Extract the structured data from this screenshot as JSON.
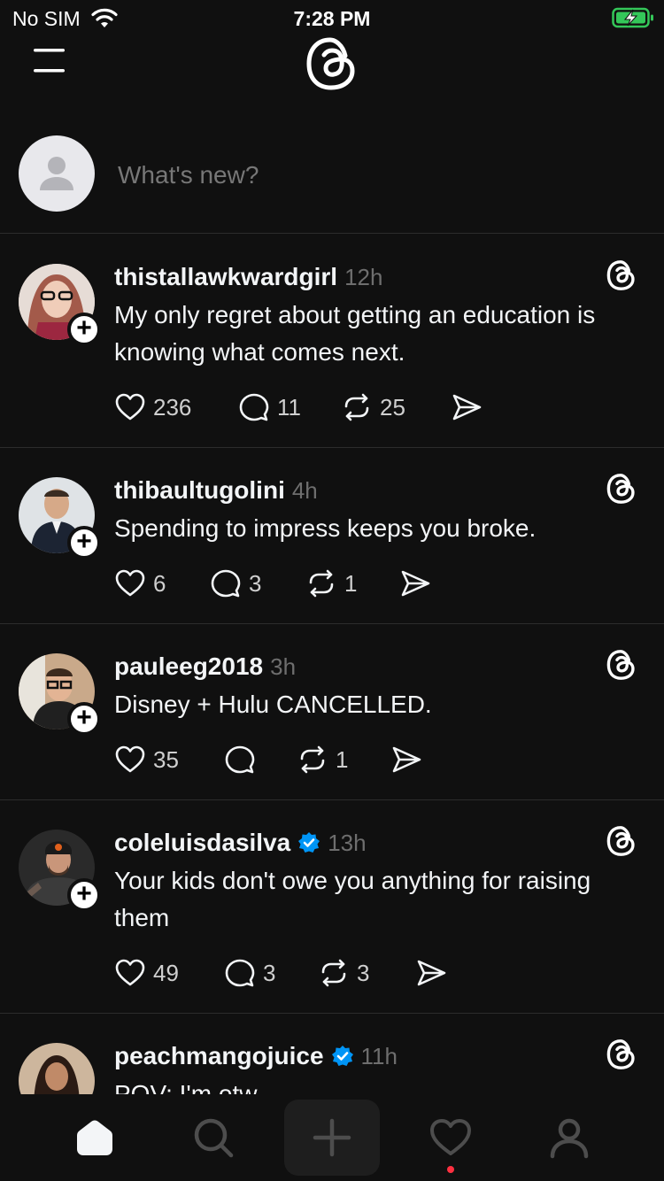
{
  "status_bar": {
    "carrier": "No SIM",
    "time": "7:28 PM",
    "battery_color": "#34c759"
  },
  "composer": {
    "placeholder": "What's new?"
  },
  "posts": [
    {
      "username": "thistallawkwardgirl",
      "verified": false,
      "time": "12h",
      "text": "My only regret about getting an education is knowing what comes next.",
      "likes": "236",
      "replies": "11",
      "reposts": "25"
    },
    {
      "username": "thibaultugolini",
      "verified": false,
      "time": "4h",
      "text": "Spending to impress keeps you broke.",
      "likes": "6",
      "replies": "3",
      "reposts": "1"
    },
    {
      "username": "pauleeg2018",
      "verified": false,
      "time": "3h",
      "text": "Disney + Hulu CANCELLED.",
      "likes": "35",
      "replies": "",
      "reposts": "1"
    },
    {
      "username": "coleluisdasilva",
      "verified": true,
      "time": "13h",
      "text": "Your kids don't owe you anything for raising them",
      "likes": "49",
      "replies": "3",
      "reposts": "3"
    },
    {
      "username": "peachmangojuice",
      "verified": true,
      "time": "11h",
      "text": "POV: I'm otw"
    }
  ],
  "tabs": [
    "home",
    "search",
    "compose",
    "activity",
    "profile"
  ],
  "colors": {
    "background": "#101010",
    "text": "#f3f5f7",
    "muted": "#6e6e6e",
    "verified": "#0095f6",
    "notification_dot": "#ff3040"
  }
}
